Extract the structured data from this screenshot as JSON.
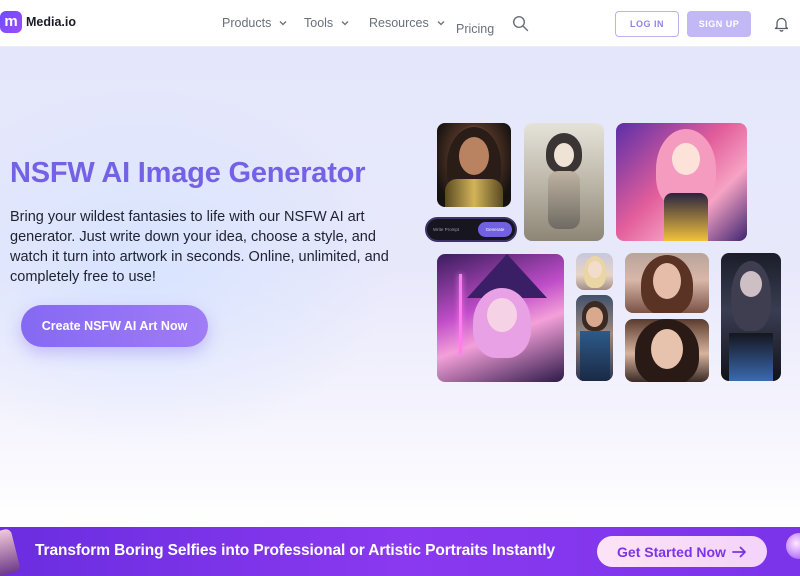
{
  "header": {
    "logo_mark": "m",
    "logo_text": "Media.io",
    "nav": {
      "products": "Products",
      "tools": "Tools",
      "resources": "Resources",
      "pricing": "Pricing"
    },
    "login_label": "LOG IN",
    "signup_label": "SIGN UP",
    "icons": [
      "search-icon",
      "bell-icon",
      "chevron-down-icon"
    ]
  },
  "hero": {
    "title": "NSFW AI Image Generator",
    "description": "Bring your wildest fantasies to life with our NSFW AI art generator. Just write down your idea, choose a style, and watch it turn into artwork in seconds. Online, unlimited, and completely free to use!",
    "cta_label": "Create NSFW AI Art Now",
    "prompt_placeholder": "Write Prompt",
    "prompt_button": "Generate"
  },
  "banner": {
    "text": "Transform Boring Selfies into Professional or Artistic Portraits Instantly",
    "button_label": "Get Started Now",
    "icon": "arrow-right-icon"
  },
  "colors": {
    "brand": "#7561e6",
    "banner": "#7b34ea",
    "cta": "#8569f2"
  }
}
